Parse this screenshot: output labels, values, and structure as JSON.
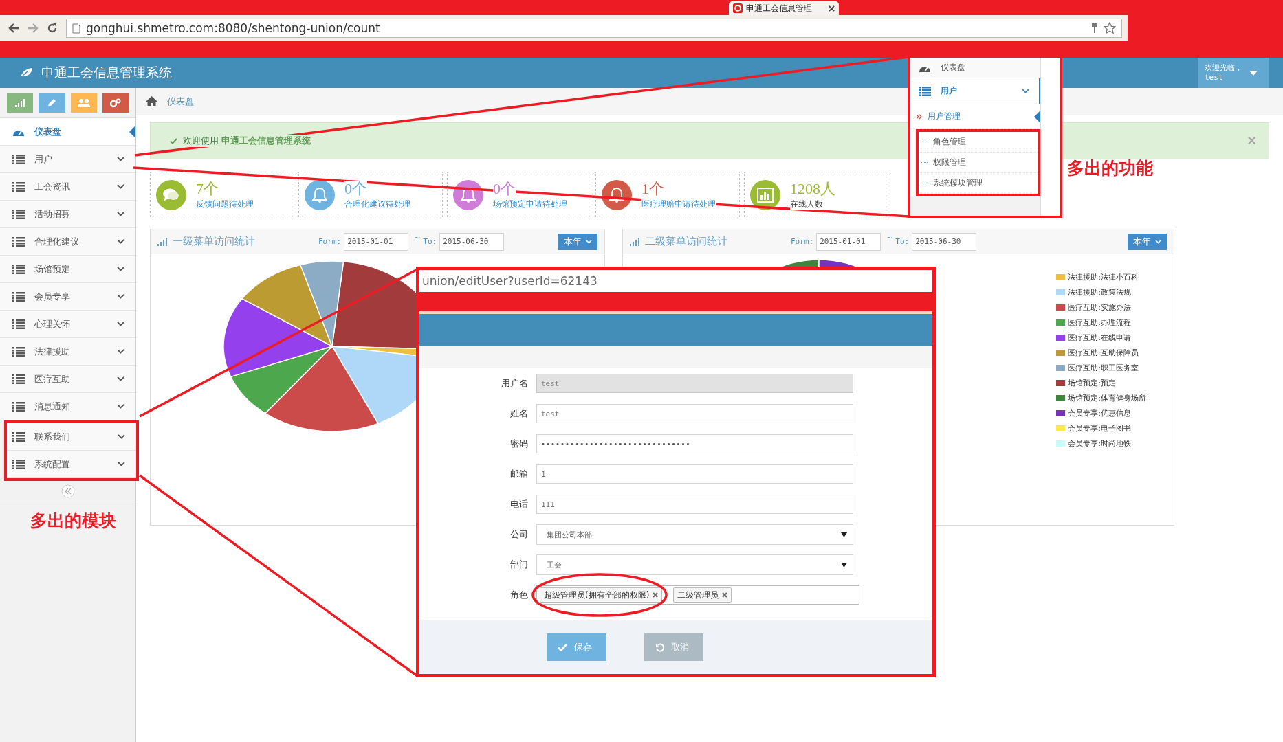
{
  "browser": {
    "tab_title": "申通工会信息管理",
    "url": "gonghui.shmetro.com:8080/shentong-union/count"
  },
  "header": {
    "title": "申通工会信息管理系统",
    "greeting": "欢迎光临，",
    "user": "test"
  },
  "shortcuts": [
    {
      "kind": "chart",
      "color": "#87b87f"
    },
    {
      "kind": "pencil",
      "color": "#6fb3e0"
    },
    {
      "kind": "users",
      "color": "#ffb752"
    },
    {
      "kind": "cogs",
      "color": "#d15b47"
    }
  ],
  "sidebar": {
    "items": [
      {
        "label": "仪表盘",
        "kind": "dashboard",
        "selected": true,
        "flagged": false
      },
      {
        "label": "用户",
        "kind": "group",
        "selected": false,
        "flagged": false
      },
      {
        "label": "工会资讯",
        "kind": "group",
        "selected": false,
        "flagged": false
      },
      {
        "label": "活动招募",
        "kind": "group",
        "selected": false,
        "flagged": false
      },
      {
        "label": "合理化建议",
        "kind": "group",
        "selected": false,
        "flagged": false
      },
      {
        "label": "场馆预定",
        "kind": "group",
        "selected": false,
        "flagged": false
      },
      {
        "label": "会员专享",
        "kind": "group",
        "selected": false,
        "flagged": false
      },
      {
        "label": "心理关怀",
        "kind": "group",
        "selected": false,
        "flagged": false
      },
      {
        "label": "法律援助",
        "kind": "group",
        "selected": false,
        "flagged": false
      },
      {
        "label": "医疗互助",
        "kind": "group",
        "selected": false,
        "flagged": false
      },
      {
        "label": "消息通知",
        "kind": "group",
        "selected": false,
        "flagged": false
      },
      {
        "label": "联系我们",
        "kind": "group",
        "selected": false,
        "flagged": true
      },
      {
        "label": "系统配置",
        "kind": "group",
        "selected": false,
        "flagged": true
      }
    ],
    "annotation": "多出的模块"
  },
  "breadcrumb": {
    "label": "仪表盘"
  },
  "alert": {
    "text": "欢迎使用 **申通工会信息管理系统**",
    "close": "×"
  },
  "stats": [
    {
      "value": "7个",
      "label": "反馈问题待处理",
      "kind": "comments",
      "color": "#9abc32",
      "link": true
    },
    {
      "value": "0个",
      "label": "合理化建议待处理",
      "kind": "bell",
      "color": "#6fb3e0",
      "link": true
    },
    {
      "value": "0个",
      "label": "场馆预定申请待处理",
      "kind": "bell",
      "color": "#cf7bd8",
      "link": true
    },
    {
      "value": "1个",
      "label": "医疗理赔申请待处理",
      "kind": "bell",
      "color": "#d15b47",
      "link": true
    },
    {
      "value": "1208人",
      "label": "在线人数",
      "kind": "chart",
      "color": "#9abc32",
      "link": false
    }
  ],
  "charts": [
    {
      "title": "一级菜单访问统计",
      "from_label": "Form:",
      "from": "2015-01-01",
      "separator": "~",
      "to_label": "To:",
      "to": "2015-06-30",
      "range": "本年"
    },
    {
      "title": "二级菜单访问统计",
      "from_label": "Form:",
      "from": "2015-01-01",
      "separator": "~",
      "to_label": "To:",
      "to": "2015-06-30",
      "range": "本年",
      "legend": [
        {
          "label": "法律援助:法律小百科",
          "color": "#eebf3f"
        },
        {
          "label": "法律援助:政策法规",
          "color": "#b0d8f7"
        },
        {
          "label": "医疗互助:实施办法",
          "color": "#cb4b4b"
        },
        {
          "label": "医疗互助:办理流程",
          "color": "#4da74d"
        },
        {
          "label": "医疗互助:在线申请",
          "color": "#9440ed"
        },
        {
          "label": "医疗互助:互助保障员",
          "color": "#bd9b33"
        },
        {
          "label": "医疗互助:职工医务室",
          "color": "#8cacc6"
        },
        {
          "label": "场馆预定:预定",
          "color": "#a23c3c"
        },
        {
          "label": "场馆预定:体育健身场所",
          "color": "#3d853d"
        },
        {
          "label": "会员专享:优惠信息",
          "color": "#7633bd"
        },
        {
          "label": "会员专享:电子图书",
          "color": "#ffe84c"
        },
        {
          "label": "会员专享:时尚地铁",
          "color": "#cbfcfc"
        }
      ]
    }
  ],
  "menu_inset": {
    "items": [
      {
        "label": "仪表盘",
        "kind": "dashboard"
      },
      {
        "label": "用户",
        "kind": "group",
        "expanded": true,
        "children": [
          {
            "label": "用户管理",
            "selected": true,
            "flagged": false
          },
          {
            "label": "角色管理",
            "selected": false,
            "flagged": true
          },
          {
            "label": "权限管理",
            "selected": false,
            "flagged": true
          },
          {
            "label": "系统模块管理",
            "selected": false,
            "flagged": true
          }
        ]
      }
    ],
    "annotation": "多出的功能"
  },
  "edit_inset": {
    "url": "union/editUser?userId=62143",
    "fields": [
      {
        "label": "用户名",
        "kind": "text",
        "value": "test",
        "disabled": true,
        "flagged": false
      },
      {
        "label": "姓名",
        "kind": "text",
        "value": "test",
        "disabled": false,
        "flagged": false
      },
      {
        "label": "密码",
        "kind": "password",
        "value": "•••••••••••••••••••••••••••••••",
        "disabled": false,
        "flagged": false
      },
      {
        "label": "邮箱",
        "kind": "text",
        "value": "1",
        "disabled": false,
        "flagged": false
      },
      {
        "label": "电话",
        "kind": "text",
        "value": "111",
        "disabled": false,
        "flagged": false
      },
      {
        "label": "公司",
        "kind": "select",
        "value": "集团公司本部",
        "disabled": false,
        "flagged": false
      },
      {
        "label": "部门",
        "kind": "select",
        "value": "工会",
        "disabled": false,
        "flagged": false
      },
      {
        "label": "角色",
        "kind": "tags",
        "tags": [
          "超级管理员(拥有全部的权限)",
          "二级管理员"
        ],
        "disabled": false,
        "flagged": true
      }
    ],
    "buttons": [
      {
        "label": "保存",
        "kind": "primary"
      },
      {
        "label": "取消",
        "kind": "secondary"
      }
    ]
  }
}
